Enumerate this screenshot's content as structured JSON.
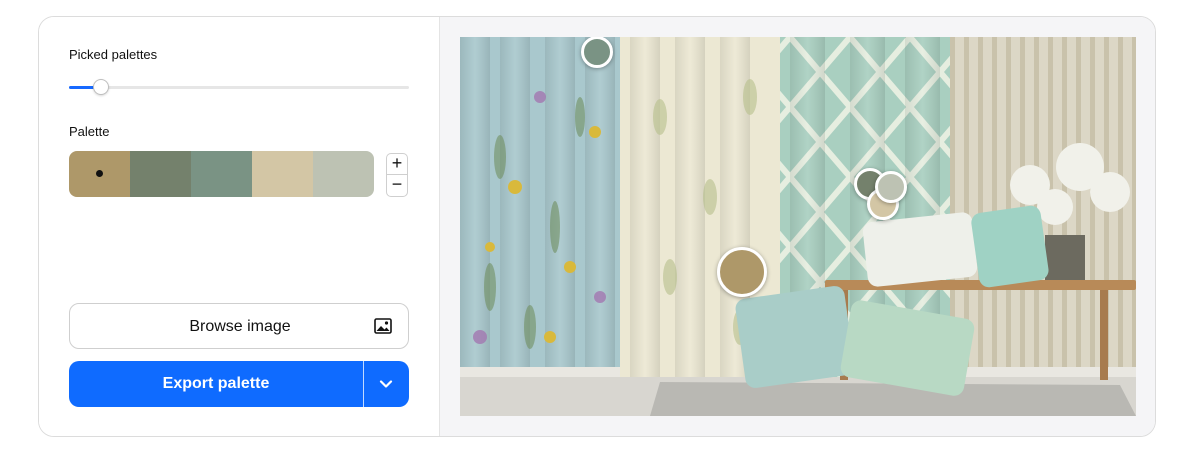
{
  "picked_palettes": {
    "label": "Picked palettes",
    "value": 5
  },
  "palette": {
    "label": "Palette",
    "swatches": [
      "#ae9869",
      "#74816c",
      "#7a9384",
      "#d3c6a5",
      "#bdc2b3"
    ],
    "selected_index": 0
  },
  "stepper": {
    "plus": "+",
    "minus": "−"
  },
  "browse": {
    "label": "Browse image",
    "icon": "image-icon"
  },
  "export": {
    "label": "Export palette",
    "dropdown_icon": "chevron-down-icon"
  },
  "accent_color": "#0f6bff"
}
